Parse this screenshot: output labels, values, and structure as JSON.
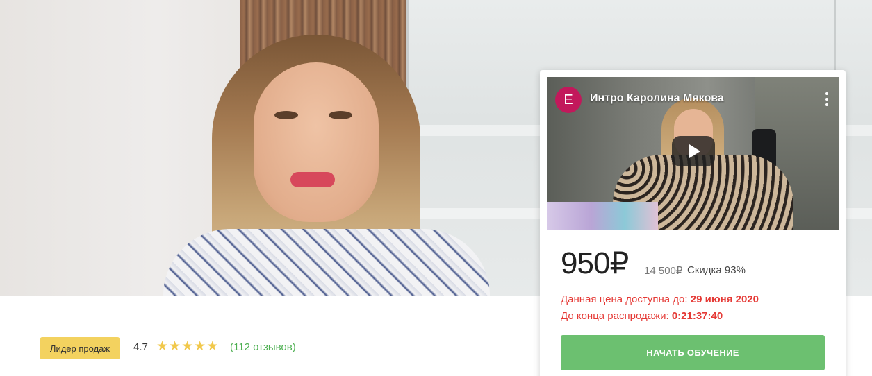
{
  "hero": {
    "image": "woman-portrait-photo"
  },
  "rating": {
    "badge": "Лидер продаж",
    "value": "4.7",
    "stars": 5,
    "reviews": "(112 отзывов)"
  },
  "card": {
    "video": {
      "channel_initial": "E",
      "title": "Интро Каролина Мякова",
      "play_icon": "play-icon",
      "menu_icon": "more-vertical-icon"
    },
    "price": "950₽",
    "old_price": "14 500₽",
    "discount": "Скидка 93%",
    "deadline_label": "Данная цена доступна до:",
    "deadline_date": "29 июня 2020",
    "countdown_label": "До конца распродажи:",
    "countdown_time": "0:21:37:40",
    "cta_label": "НАЧАТЬ ОБУЧЕНИЕ"
  },
  "colors": {
    "badge": "#f3d25f",
    "star": "#f1c84b",
    "reviews": "#4caf50",
    "alert": "#e53935",
    "cta": "#6cc070",
    "avatar": "#c2185b"
  }
}
